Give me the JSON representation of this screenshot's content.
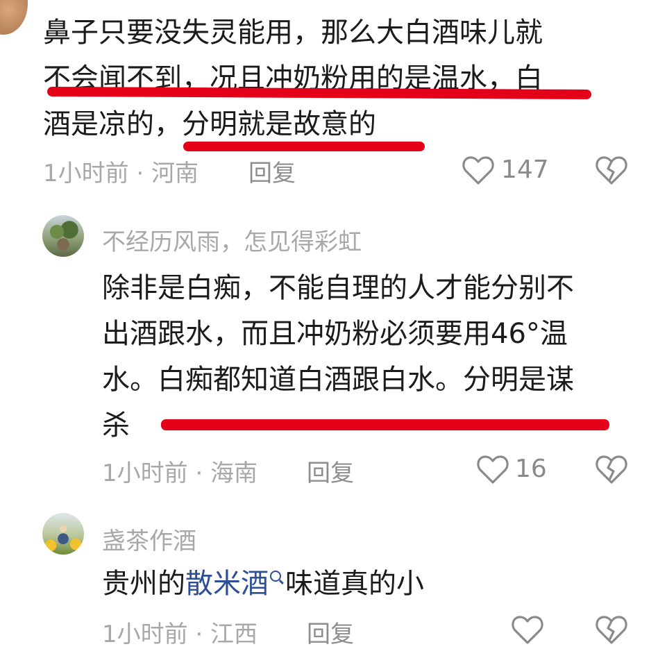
{
  "comment1": {
    "lines": [
      "鼻子只要没失灵能用，那么大白酒味儿就",
      "不会闻不到，况且冲奶粉用的是温水，白",
      "酒是凉的，分明就是故意的"
    ],
    "meta": "1小时前 · 河南",
    "reply_label": "回复",
    "likes": "147"
  },
  "comment2": {
    "username": "不经历风雨，怎见得彩虹",
    "lines": [
      "除非是白痴，不能自理的人才能分别不",
      "出酒跟水，而且冲奶粉必须要用46°温",
      "水。白痴都知道白酒跟白水。分明是谋",
      "杀"
    ],
    "meta": "1小时前 · 海南",
    "reply_label": "回复",
    "likes": "16"
  },
  "comment3": {
    "username": "盏茶作酒",
    "text_before": "贵州的",
    "link_text": "散米酒",
    "text_after": "味道真的小",
    "meta": "1小时前 · 江西",
    "reply_label": "回复"
  },
  "colors": {
    "underline": "#e5001a",
    "link": "#2d4f95",
    "meta_text": "#a8a8a8"
  },
  "icons": {
    "like": "heart-outline-icon",
    "dislike": "broken-heart-icon",
    "link_search": "search-icon"
  }
}
